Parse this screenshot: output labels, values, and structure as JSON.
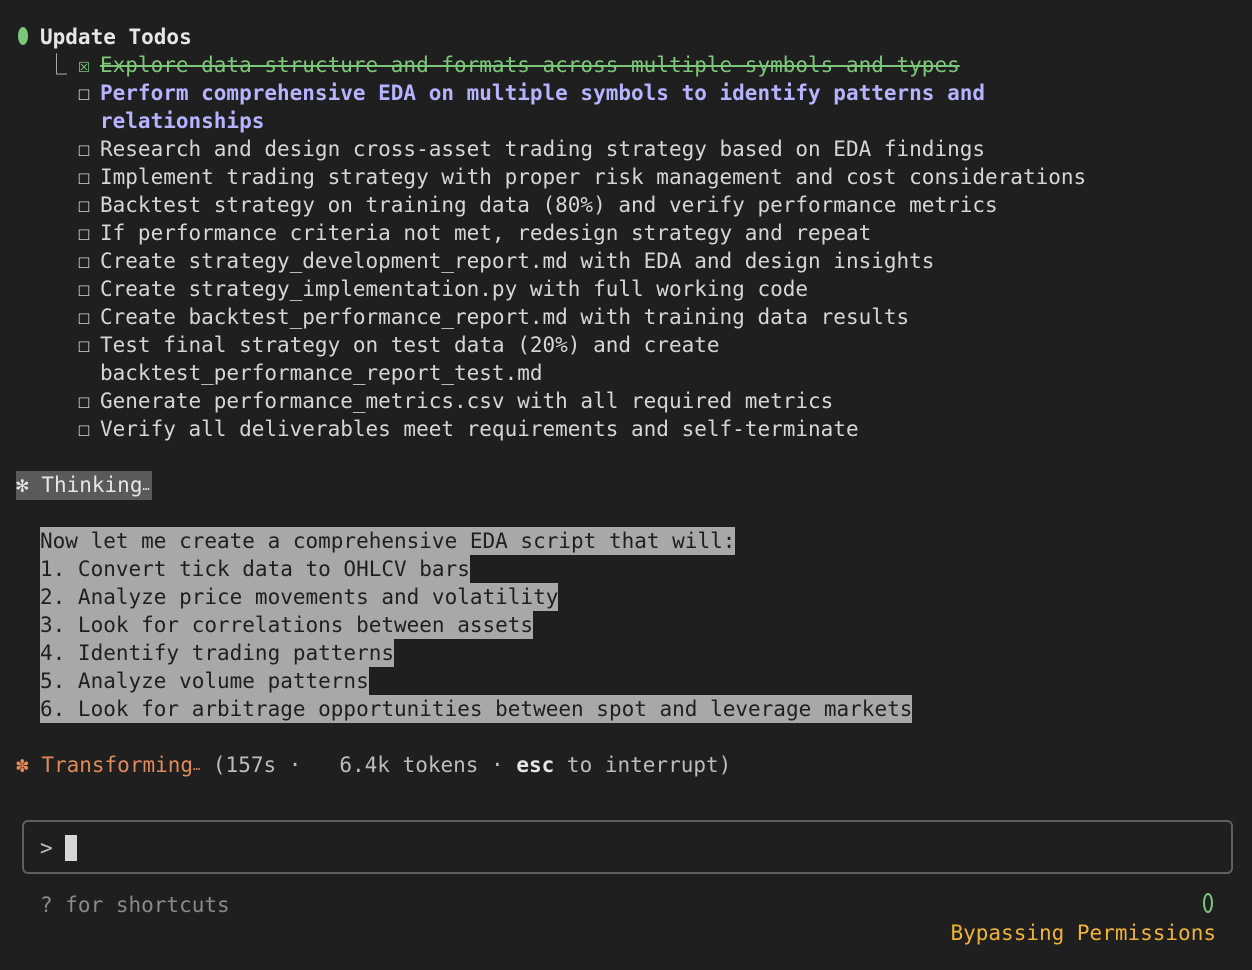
{
  "header": {
    "title": "Update Todos",
    "branch": "⎿"
  },
  "todos": [
    {
      "status": "done",
      "box": "☒",
      "lines": [
        "Explore data structure and formats across multiple symbols and types"
      ]
    },
    {
      "status": "active",
      "box": "☐",
      "lines": [
        "Perform comprehensive EDA on multiple symbols to identify patterns and",
        "relationships"
      ]
    },
    {
      "status": "pending",
      "box": "☐",
      "lines": [
        "Research and design cross-asset trading strategy based on EDA findings"
      ]
    },
    {
      "status": "pending",
      "box": "☐",
      "lines": [
        "Implement trading strategy with proper risk management and cost considerations"
      ]
    },
    {
      "status": "pending",
      "box": "☐",
      "lines": [
        "Backtest strategy on training data (80%) and verify performance metrics"
      ]
    },
    {
      "status": "pending",
      "box": "☐",
      "lines": [
        "If performance criteria not met, redesign strategy and repeat"
      ]
    },
    {
      "status": "pending",
      "box": "☐",
      "lines": [
        "Create strategy_development_report.md with EDA and design insights"
      ]
    },
    {
      "status": "pending",
      "box": "☐",
      "lines": [
        "Create strategy_implementation.py with full working code"
      ]
    },
    {
      "status": "pending",
      "box": "☐",
      "lines": [
        "Create backtest_performance_report.md with training data results"
      ]
    },
    {
      "status": "pending",
      "box": "☐",
      "lines": [
        "Test final strategy on test data (20%) and create",
        "backtest_performance_report_test.md"
      ]
    },
    {
      "status": "pending",
      "box": "☐",
      "lines": [
        "Generate performance_metrics.csv with all required metrics"
      ]
    },
    {
      "status": "pending",
      "box": "☐",
      "lines": [
        "Verify all deliverables meet requirements and self-terminate"
      ]
    }
  ],
  "thinking": {
    "star": "✻",
    "label": "Thinking",
    "ellipsis": "…",
    "lines": [
      "Now let me create a comprehensive EDA script that will:",
      "1. Convert tick data to OHLCV bars",
      "2. Analyze price movements and volatility",
      "3. Look for correlations between assets",
      "4. Identify trading patterns",
      "5. Analyze volume patterns",
      "6. Look for arbitrage opportunities between spot and leverage markets"
    ]
  },
  "status": {
    "star": "✽",
    "word": "Transforming",
    "ellipsis": "…",
    "meta_prefix": " (157s ·   6.4k tokens · ",
    "key": "esc",
    "meta_suffix": " to interrupt)"
  },
  "input": {
    "prompt": ">",
    "value": ""
  },
  "footer": {
    "hint": "? for shortcuts",
    "mode": "Bypassing Permissions"
  },
  "colors": {
    "background": "#1f1f1f",
    "done": "#7cc77a",
    "active": "#b6b3ff",
    "accent": "#e08a5a",
    "mode": "#f0b33a"
  }
}
